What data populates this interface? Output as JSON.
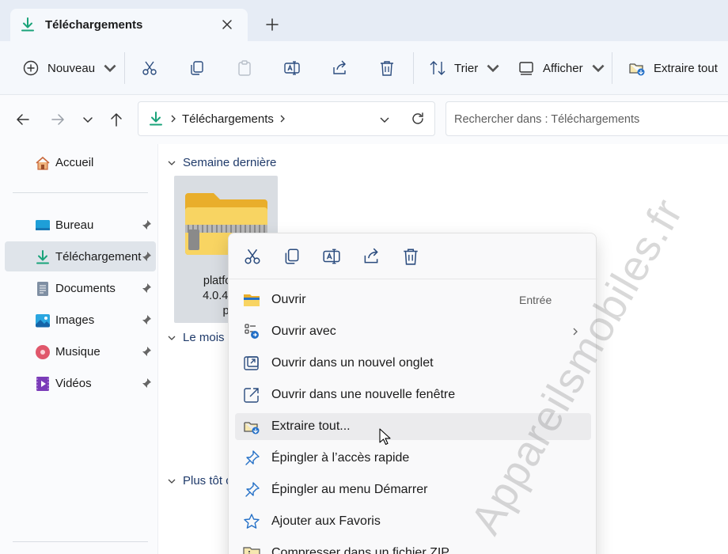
{
  "tab": {
    "title": "Téléchargements"
  },
  "toolbar": {
    "new_label": "Nouveau",
    "sort_label": "Trier",
    "view_label": "Afficher",
    "extract_label": "Extraire tout"
  },
  "address": {
    "path": "Téléchargements",
    "search_placeholder": "Rechercher dans : Téléchargements"
  },
  "sidebar": {
    "items": [
      {
        "label": "Accueil"
      },
      {
        "label": "Bureau"
      },
      {
        "label": "Téléchargement"
      },
      {
        "label": "Documents"
      },
      {
        "label": "Images"
      },
      {
        "label": "Musique"
      },
      {
        "label": "Vidéos"
      }
    ]
  },
  "content": {
    "groups": [
      {
        "label": "Semaine dernière"
      },
      {
        "label": "Le mois d"
      },
      {
        "label": "Plus tôt c"
      }
    ],
    "file": {
      "line1": "platform-",
      "line2": "4.0.4-win",
      "line3": "p"
    }
  },
  "context_menu": {
    "items": [
      {
        "label": "Ouvrir",
        "shortcut": "Entrée"
      },
      {
        "label": "Ouvrir avec"
      },
      {
        "label": "Ouvrir dans un nouvel onglet"
      },
      {
        "label": "Ouvrir dans une nouvelle fenêtre"
      },
      {
        "label": "Extraire tout..."
      },
      {
        "label": "Épingler à l’accès rapide"
      },
      {
        "label": "Épingler au menu Démarrer"
      },
      {
        "label": "Ajouter aux Favoris"
      },
      {
        "label": "Compresser dans un fichier ZIP"
      }
    ]
  },
  "watermark": "Appareilsmobiles.fr",
  "colors": {
    "accent_green": "#1aa37a",
    "folder_yellow": "#f5c84a",
    "link_blue": "#1f3a6a",
    "selection_gray": "#dfe4ea"
  },
  "icons": [
    "download-icon",
    "close-icon",
    "plus-icon",
    "cut-icon",
    "copy-icon",
    "paste-icon",
    "rename-icon",
    "share-icon",
    "delete-icon",
    "sort-icon",
    "view-icon",
    "extract-icon",
    "back-icon",
    "forward-icon",
    "up-icon",
    "refresh-icon",
    "home-icon",
    "desktop-icon",
    "documents-icon",
    "images-icon",
    "music-icon",
    "videos-icon",
    "pin-icon",
    "zip-folder-icon",
    "open-with-icon",
    "new-tab-icon",
    "new-window-icon",
    "star-icon",
    "mouse-cursor-icon"
  ]
}
